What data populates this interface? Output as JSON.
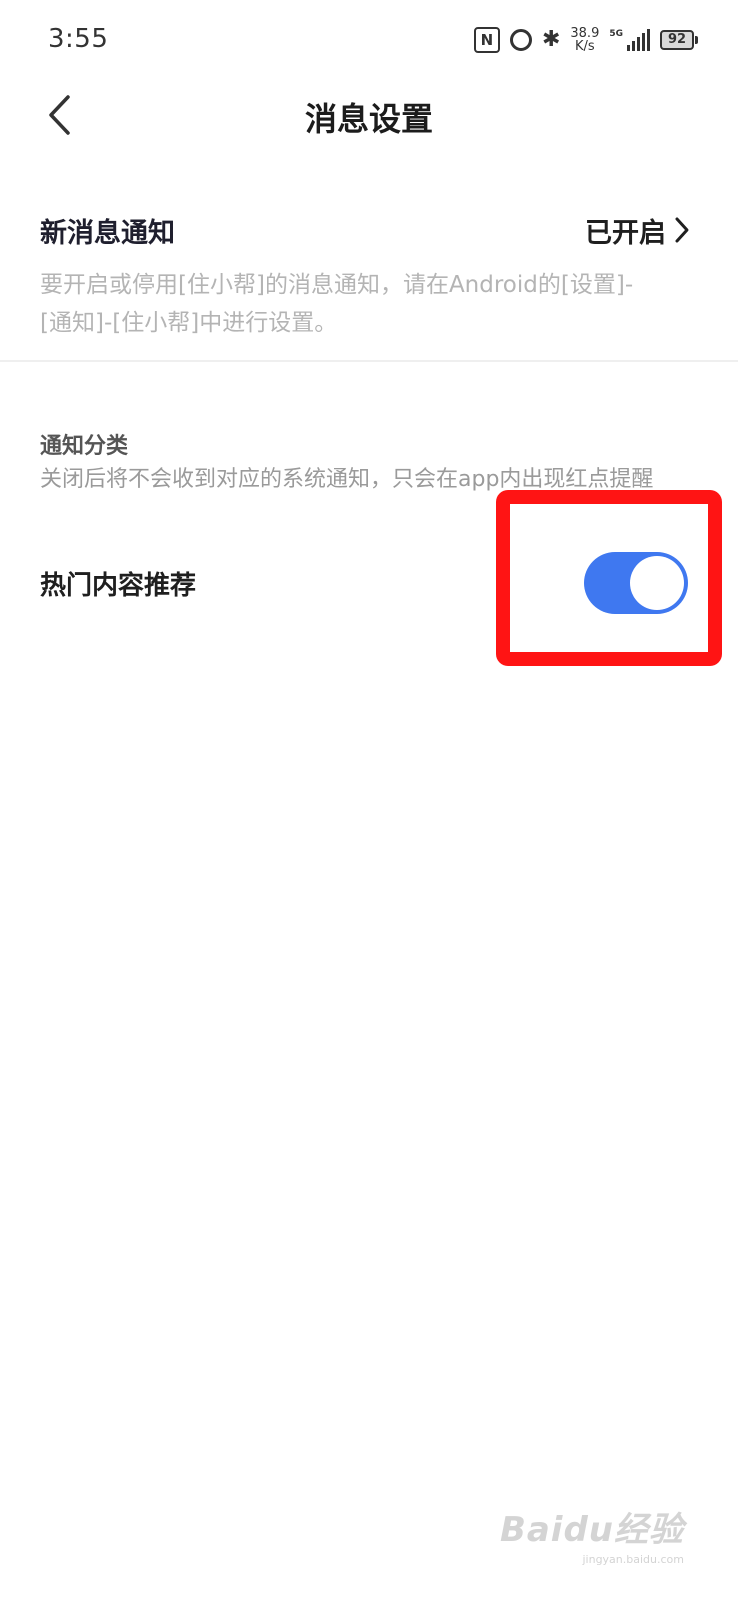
{
  "status_bar": {
    "time": "3:55",
    "nfc_label": "N",
    "speed_value": "38.9",
    "speed_unit": "K/s",
    "network_type": "5G",
    "battery": "92",
    "icons": [
      "nfc-icon",
      "alarm-icon",
      "bluetooth-icon",
      "signal-icon",
      "battery-icon"
    ]
  },
  "header": {
    "title": "消息设置",
    "back_icon": "chevron-left-icon"
  },
  "new_message": {
    "label": "新消息通知",
    "value": "已开启",
    "description": "要开启或停用[住小帮]的消息通知，请在Android的[设置]-[通知]-[住小帮]中进行设置。",
    "chevron_icon": "chevron-right-icon"
  },
  "category": {
    "title": "通知分类",
    "description": "关闭后将不会收到对应的系统通知，只会在app内出现红点提醒",
    "items": [
      {
        "label": "热门内容推荐",
        "enabled": true
      }
    ]
  },
  "colors": {
    "toggle_on": "#3f78f0",
    "highlight": "#ff1414"
  },
  "watermark": {
    "logo": "Baidu经验",
    "url": "jingyan.baidu.com"
  }
}
